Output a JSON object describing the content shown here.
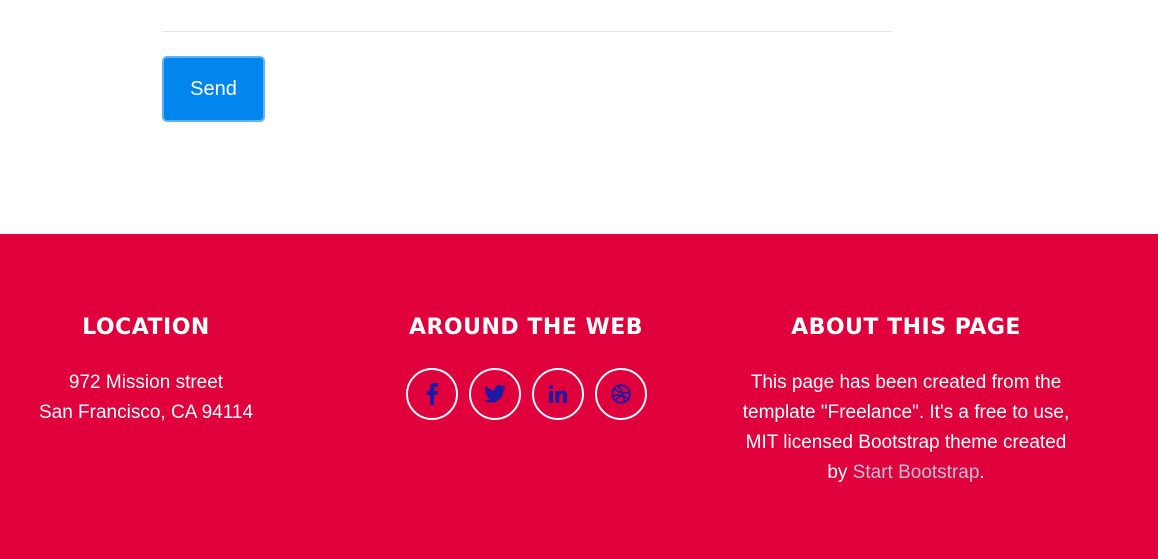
{
  "form": {
    "send_label": "Send"
  },
  "footer": {
    "location": {
      "heading": "LOCATION",
      "line1": "972 Mission street",
      "line2": "San Francisco, CA 94114"
    },
    "web": {
      "heading": "AROUND THE WEB",
      "links": [
        {
          "icon": "facebook-icon"
        },
        {
          "icon": "twitter-icon"
        },
        {
          "icon": "linkedin-icon"
        },
        {
          "icon": "dribbble-icon"
        }
      ]
    },
    "about": {
      "heading": "ABOUT THIS PAGE",
      "text_line1": "This page has been created from the",
      "text_line2": "template \"Freelance\". It's a free to use,",
      "text_line3": "MIT licensed Bootstrap theme created",
      "text_prefix": "by ",
      "link_label": "Start Bootstrap",
      "text_suffix": "."
    }
  },
  "colors": {
    "footer_bg": "#e0003c",
    "button_bg": "#0086ee",
    "icon_color": "#1a1aa6",
    "link_color": "#b8c0d8"
  }
}
